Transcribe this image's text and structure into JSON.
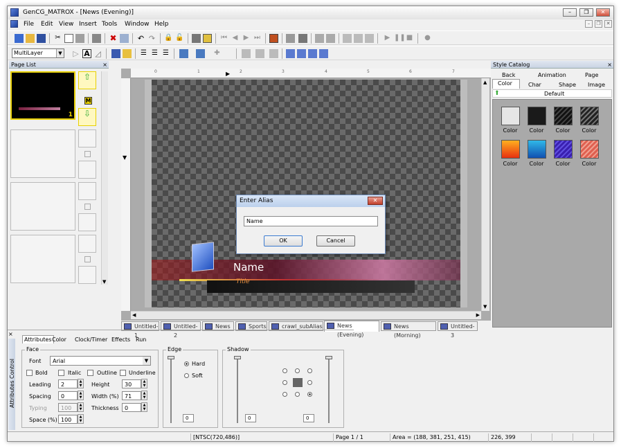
{
  "window": {
    "title": "GenCG_MATROX - [News (Evening)]"
  },
  "menu": [
    "File",
    "Edit",
    "View",
    "Insert",
    "Tools",
    "Window",
    "Help"
  ],
  "toolbar2": {
    "layer_select": "MultiLayer"
  },
  "page_list": {
    "title": "Page List",
    "close": "×",
    "first_page_number": "1",
    "master_label": "M"
  },
  "style_catalog": {
    "title": "Style Catalog",
    "tabs_row1": [
      "Back",
      "Animation",
      "Page"
    ],
    "tabs_row2": [
      "Color",
      "Char",
      "Shape",
      "Image"
    ],
    "default_label": "Default",
    "swatch_label": "Color",
    "colors": [
      "#e6e6e6",
      "#1a1a1a",
      "#262626",
      "#444444",
      "#ff8c1a",
      "#2aa6d8",
      "#4a36c8",
      "#e8786a"
    ]
  },
  "document_tabs": [
    "Untitled-1",
    "Untitled-2",
    "News",
    "Sports",
    "crawl_subAlias",
    "News (Evening)",
    "News (Morning)",
    "Untitled-3"
  ],
  "active_tab": "News (Evening)",
  "ruler_labels": [
    "0",
    "1",
    "2",
    "3",
    "4",
    "5",
    "6",
    "7"
  ],
  "canvas": {
    "name_text": "Name",
    "title_text": "Title"
  },
  "dialog": {
    "title": "Enter Alias",
    "close": "✕",
    "input_value": "Name",
    "ok": "OK",
    "cancel": "Cancel"
  },
  "attributes": {
    "side_label": "Attributes Control",
    "tabs": [
      "Attributes",
      "Color",
      "Clock/Timer",
      "Effects",
      "Run"
    ],
    "face": {
      "group": "Face",
      "font_label": "Font",
      "font_value": "Arial",
      "bold": "Bold",
      "italic": "Italic",
      "outline": "Outline",
      "underline": "Underline",
      "leading_label": "Leading",
      "leading": "2",
      "height_label": "Height",
      "height": "30",
      "spacing_label": "Spacing",
      "spacing": "0",
      "width_label": "Width (%)",
      "width": "71",
      "typing_label": "Typing",
      "typing": "100",
      "thickness_label": "Thickness",
      "thickness": "0",
      "space_label": "Space (%)",
      "space": "100"
    },
    "edge": {
      "group": "Edge",
      "hard": "Hard",
      "soft": "Soft",
      "value": "0"
    },
    "shadow": {
      "group": "Shadow",
      "value1": "0",
      "value2": "0"
    }
  },
  "status": {
    "format": "[NTSC(720,486)]",
    "page": "Page 1 / 1",
    "area": "Area = (188, 381, 251, 415)",
    "cursor": "226, 399"
  }
}
